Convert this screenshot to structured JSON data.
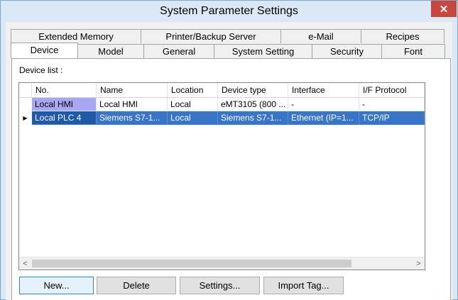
{
  "window": {
    "title": "System Parameter Settings",
    "close_glyph": "✕"
  },
  "tabs_row1": [
    {
      "label": "Extended Memory"
    },
    {
      "label": "Printer/Backup Server"
    },
    {
      "label": "e-Mail"
    },
    {
      "label": "Recipes"
    }
  ],
  "tabs_row2": [
    {
      "label": "Device",
      "active": true
    },
    {
      "label": "Model"
    },
    {
      "label": "General"
    },
    {
      "label": "System Setting"
    },
    {
      "label": "Security"
    },
    {
      "label": "Font"
    }
  ],
  "device_list": {
    "label": "Device list :",
    "columns": [
      "No.",
      "Name",
      "Location",
      "Device type",
      "Interface",
      "I/F Protocol"
    ],
    "rows": [
      {
        "cells": [
          "Local HMI",
          "Local HMI",
          "Local",
          "eMT3105 (800 ...",
          "-",
          "-"
        ],
        "selected": false
      },
      {
        "cells": [
          "Local PLC 4",
          "Siemens S7-1...",
          "Local",
          "Siemens S7-1...",
          "Ethernet (IP=1...",
          "TCP/IP"
        ],
        "selected": true
      }
    ],
    "current_row_glyph": "▶",
    "scroll_left_glyph": "<",
    "scroll_right_glyph": ">"
  },
  "buttons": {
    "new_label": "New...",
    "delete_label": "Delete",
    "settings_label": "Settings...",
    "import_tag_label": "Import Tag..."
  }
}
